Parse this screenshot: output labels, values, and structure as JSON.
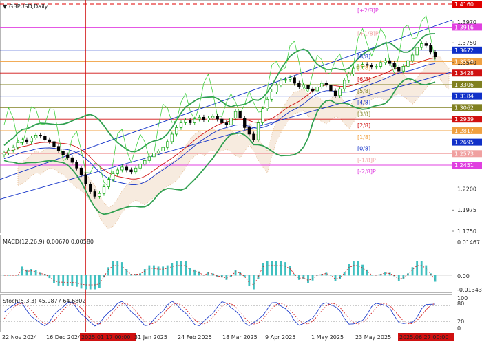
{
  "chart_data": {
    "type": "candlestick",
    "title": "GBPUSD,Daily",
    "symbol": "GBPUSD",
    "timeframe": "Daily",
    "y_axis_ticks": [
      "1.3970",
      "1.3750",
      "1.3540",
      "1.2200",
      "1.1975",
      "1.1750"
    ],
    "price_levels": [
      {
        "value": "1.4160",
        "color": "#e00000",
        "style": "dashed"
      },
      {
        "value": "1.3916",
        "color": "#e040e0"
      },
      {
        "value": "1.3672",
        "color": "#1030c8"
      },
      {
        "value": "1.3550",
        "color": "#f0a040"
      },
      {
        "value": "1.3428",
        "color": "#d01010"
      },
      {
        "value": "1.3306",
        "color": "#808020"
      },
      {
        "value": "1.3184",
        "color": "#1030c8"
      },
      {
        "value": "1.3062",
        "color": "#808020"
      },
      {
        "value": "1.2939",
        "color": "#d01010"
      },
      {
        "value": "1.2817",
        "color": "#f0a040"
      },
      {
        "value": "1.2695",
        "color": "#1030c8"
      },
      {
        "value": "1.2573",
        "color": "#f0a0a0"
      },
      {
        "value": "1.2451",
        "color": "#e040e0"
      }
    ],
    "murrey_labels": [
      {
        "label": "[+2/8]P",
        "color": "#e040e0"
      },
      {
        "label": "[+1/8]P",
        "color": "#f0a0a0"
      },
      {
        "label": "[8/8]",
        "color": "#1030c8"
      },
      {
        "label": "[7/8]",
        "color": "#f0a040"
      },
      {
        "label": "[6/8]",
        "color": "#d01010"
      },
      {
        "label": "[5/8]",
        "color": "#808020"
      },
      {
        "label": "[4/8]",
        "color": "#1030c8"
      },
      {
        "label": "[3/8]",
        "color": "#808020"
      },
      {
        "label": "[2/8]",
        "color": "#d01010"
      },
      {
        "label": "[1/8]",
        "color": "#f0a040"
      },
      {
        "label": "[0/8]",
        "color": "#1030c8"
      },
      {
        "label": "[-1/8]P",
        "color": "#f0a0a0"
      },
      {
        "label": "[-2/8]P",
        "color": "#e040e0"
      }
    ],
    "x_tick_labels": [
      "22 Nov 2024",
      "16 Dec 2024",
      "2025.01.17 00:00",
      "31 Jan 2025",
      "24 Feb 2025",
      "18 Mar 2025",
      "9 Apr 2025",
      "1 May 2025",
      "23 May 2025",
      "2025.06.27 00:00"
    ],
    "x_highlighted_labels": [
      "2025.01.17 00:00",
      "2025.06.27 00:00"
    ],
    "candles_close": [
      1.258,
      1.261,
      1.264,
      1.269,
      1.272,
      1.27,
      1.274,
      1.277,
      1.276,
      1.272,
      1.27,
      1.265,
      1.26,
      1.256,
      1.253,
      1.248,
      1.242,
      1.235,
      1.225,
      1.217,
      1.212,
      1.215,
      1.222,
      1.23,
      1.236,
      1.24,
      1.243,
      1.24,
      1.238,
      1.242,
      1.246,
      1.25,
      1.254,
      1.258,
      1.26,
      1.264,
      1.27,
      1.278,
      1.285,
      1.29,
      1.293,
      1.29,
      1.294,
      1.296,
      1.293,
      1.295,
      1.297,
      1.294,
      1.29,
      1.288,
      1.295,
      1.302,
      1.295,
      1.285,
      1.278,
      1.272,
      1.29,
      1.305,
      1.315,
      1.323,
      1.33,
      1.335,
      1.336,
      1.338,
      1.332,
      1.328,
      1.33,
      1.326,
      1.324,
      1.328,
      1.332,
      1.33,
      1.324,
      1.319,
      1.326,
      1.335,
      1.342,
      1.348,
      1.35,
      1.352,
      1.351,
      1.349,
      1.35,
      1.354,
      1.356,
      1.353,
      1.349,
      1.345,
      1.35,
      1.356,
      1.362,
      1.37,
      1.374,
      1.372,
      1.365,
      1.36
    ],
    "macd": {
      "label": "MACD(12,26,9) 0.00670 0.00580",
      "params": "12,26,9",
      "values": [
        "0.00670",
        "0.00580"
      ],
      "ticks": [
        "0.01467",
        "0.00",
        "-0.01343"
      ]
    },
    "stochastic": {
      "label": "Stoch(5,3,3) 45.9877 64.6802",
      "params": "5,3,3",
      "values": [
        "45.9877",
        "64.6802"
      ],
      "ticks": [
        "100",
        "80",
        "20",
        "0"
      ]
    },
    "colors": {
      "bull": "#00a000",
      "bear": "#000000",
      "channel": "#1030c8",
      "bollinger": "#30a050",
      "signal": "#d01010",
      "rsi_like": "#40d040",
      "cloud": "#e0b080",
      "macd_hist": "#40c0c0",
      "vline": "#d01010"
    }
  }
}
